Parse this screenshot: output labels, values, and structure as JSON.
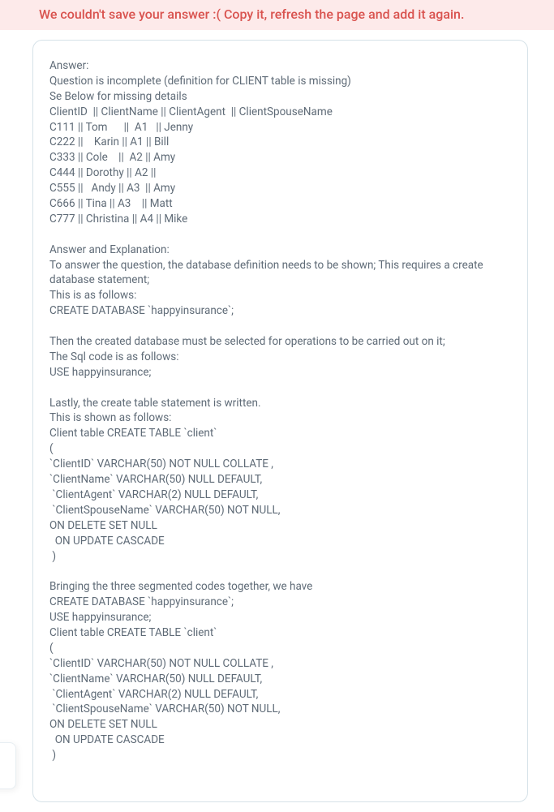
{
  "error_banner": {
    "message": "We couldn't save your answer :( Copy it, refresh the page and add it again."
  },
  "answer": {
    "body": "Answer:\nQuestion is incomplete (definition for CLIENT table is missing)\nSe Below for missing details\nClientID  || ClientName || ClientAgent  || ClientSpouseName\nC111 || Tom      ||  A1   || Jenny\nC222 ||    Karin || A1 || Bill\nC333 || Cole    ||  A2 || Amy\nC444 || Dorothy || A2 ||\nC555 ||   Andy || A3  || Amy\nC666 || Tina || A3    || Matt\nC777 || Christina || A4 || Mike\n\nAnswer and Explanation:\nTo answer the question, the database definition needs to be shown; This requires a create database statement;\nThis is as follows:\nCREATE DATABASE `happyinsurance`;\n\nThen the created database must be selected for operations to be carried out on it;\nThe Sql code is as follows:\nUSE happyinsurance;\n\nLastly, the create table statement is written.\nThis is shown as follows:\nClient table CREATE TABLE `client`\n(\n`ClientID` VARCHAR(50) NOT NULL COLLATE ,\n`ClientName` VARCHAR(50) NULL DEFAULT,\n `ClientAgent` VARCHAR(2) NULL DEFAULT,\n `ClientSpouseName` VARCHAR(50) NOT NULL,\nON DELETE SET NULL\n  ON UPDATE CASCADE\n )\n\nBringing the three segmented codes together, we have\nCREATE DATABASE `happyinsurance`;\nUSE happyinsurance;\nClient table CREATE TABLE `client`\n(\n`ClientID` VARCHAR(50) NOT NULL COLLATE ,\n`ClientName` VARCHAR(50) NULL DEFAULT,\n `ClientAgent` VARCHAR(2) NULL DEFAULT,\n `ClientSpouseName` VARCHAR(50) NOT NULL,\nON DELETE SET NULL\n  ON UPDATE CASCADE\n )"
  }
}
